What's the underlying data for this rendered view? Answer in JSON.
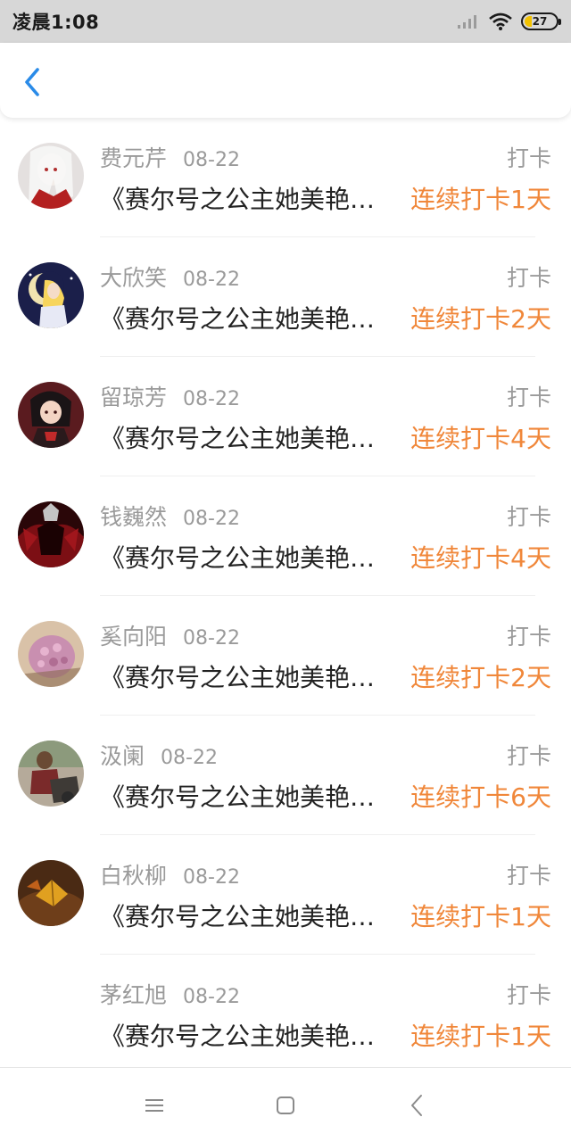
{
  "status_bar": {
    "time": "凌晨1:08",
    "battery": "27",
    "icons": [
      "signal-icon",
      "wifi-icon",
      "battery-icon"
    ]
  },
  "nav": {
    "back_icon": "chevron-left-icon",
    "accent": "#2a8be8"
  },
  "colors": {
    "streak": "#f0873a",
    "muted": "#9a9a9a",
    "text": "#222222"
  },
  "items": [
    {
      "name": "费元芹",
      "date": "08-22",
      "action": "打卡",
      "title": "《赛尔号之公主她美艳…",
      "streak": "连续打卡1天"
    },
    {
      "name": "大欣笑",
      "date": "08-22",
      "action": "打卡",
      "title": "《赛尔号之公主她美艳…",
      "streak": "连续打卡2天"
    },
    {
      "name": "留琼芳",
      "date": "08-22",
      "action": "打卡",
      "title": "《赛尔号之公主她美艳…",
      "streak": "连续打卡4天"
    },
    {
      "name": "钱巍然",
      "date": "08-22",
      "action": "打卡",
      "title": "《赛尔号之公主她美艳…",
      "streak": "连续打卡4天"
    },
    {
      "name": "奚向阳",
      "date": "08-22",
      "action": "打卡",
      "title": "《赛尔号之公主她美艳…",
      "streak": "连续打卡2天"
    },
    {
      "name": "汲阑",
      "date": "08-22",
      "action": "打卡",
      "title": "《赛尔号之公主她美艳…",
      "streak": "连续打卡6天"
    },
    {
      "name": "白秋柳",
      "date": "08-22",
      "action": "打卡",
      "title": "《赛尔号之公主她美艳…",
      "streak": "连续打卡1天"
    },
    {
      "name": "茅红旭",
      "date": "08-22",
      "action": "打卡",
      "title": "《赛尔号之公主她美艳…",
      "streak": "连续打卡1天"
    }
  ],
  "bottom_nav": [
    "menu-icon",
    "home-square-icon",
    "back-triangle-icon"
  ]
}
